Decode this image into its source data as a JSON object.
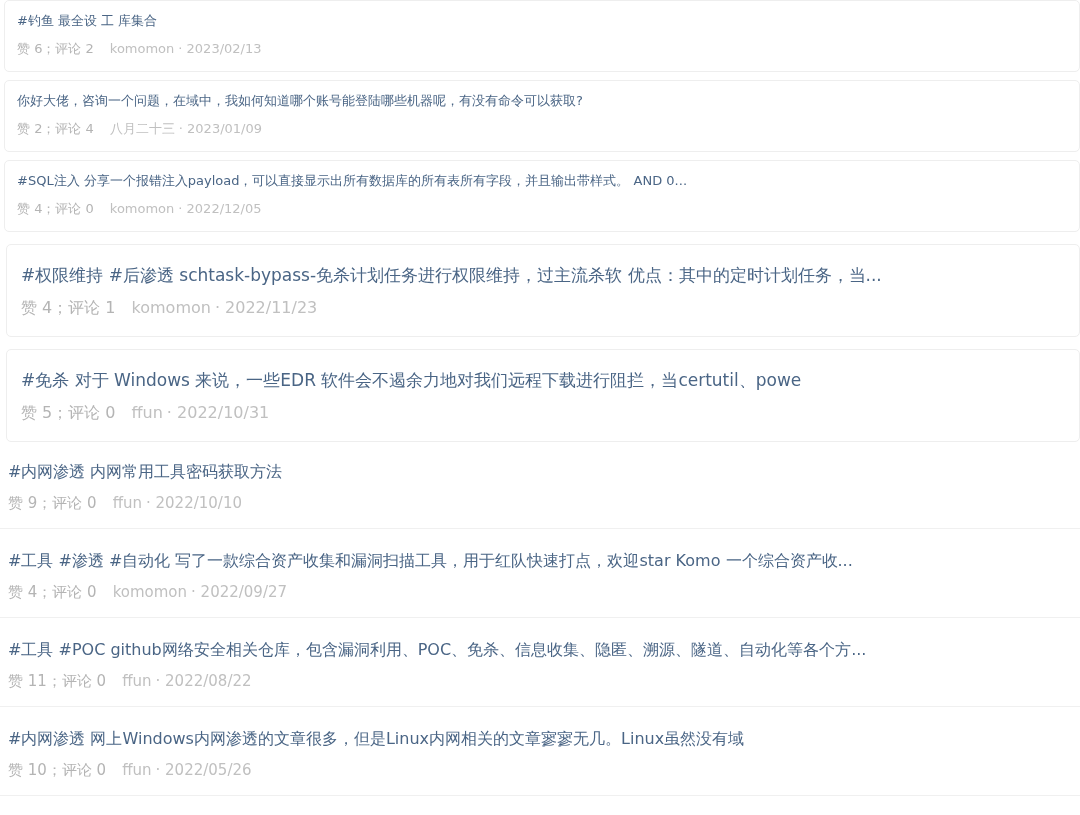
{
  "posts": [
    {
      "kind": "small",
      "title": "#钓鱼 最全设 工 库集合",
      "stats": "赞 6；评论 2",
      "author": "komomon",
      "date": "· 2023/02/13"
    },
    {
      "kind": "small",
      "title": "你好大佬，咨询一个问题，在域中，我如何知道哪个账号能登陆哪些机器呢，有没有命令可以获取?",
      "stats": "赞 2；评论 4",
      "author": "八月二十三",
      "date": "· 2023/01/09"
    },
    {
      "kind": "small",
      "title": "#SQL注入 分享一个报错注入payload，可以直接显示出所有数据库的所有表所有字段，并且输出带样式。 AND 0...",
      "stats": "赞 4；评论 0",
      "author": "komomon",
      "date": "· 2022/12/05"
    },
    {
      "kind": "large",
      "title": "#权限维持 #后渗透 schtask-bypass-免杀计划任务进行权限维持，过主流杀软 优点：其中的定时计划任务，当...",
      "stats": "赞 4；评论 1",
      "author": "komomon",
      "date": "· 2022/11/23"
    },
    {
      "kind": "large",
      "title": "#免杀 对于 Windows 来说，一些EDR 软件会不遏余力地对我们远程下载进行阻拦，当certutil、powe",
      "stats": "赞 5；评论 0",
      "author": "ffun",
      "date": "· 2022/10/31"
    },
    {
      "kind": "plain",
      "title": "#内网渗透 内网常用工具密码获取方法",
      "stats": "赞 9；评论 0",
      "author": "ffun",
      "date": "· 2022/10/10"
    },
    {
      "kind": "plain",
      "title": "#工具 #渗透 #自动化 写了一款综合资产收集和漏洞扫描工具，用于红队快速打点，欢迎star Komo 一个综合资产收...",
      "stats": "赞 4；评论 0",
      "author": "komomon",
      "date": "· 2022/09/27"
    },
    {
      "kind": "plain",
      "title": "#工具 #POC github网络安全相关仓库，包含漏洞利用、POC、免杀、信息收集、隐匿、溯源、隧道、自动化等各个方...",
      "stats": "赞 11；评论 0",
      "author": "ffun",
      "date": "· 2022/08/22"
    },
    {
      "kind": "plain",
      "title": "#内网渗透 网上Windows内网渗透的文章很多，但是Linux内网相关的文章寥寥无几。Linux虽然没有域",
      "stats": "赞 10；评论 0",
      "author": "ffun",
      "date": "· 2022/05/26"
    }
  ]
}
